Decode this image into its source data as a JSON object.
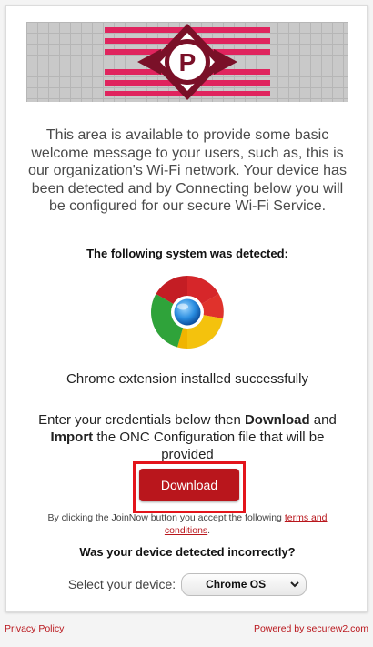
{
  "welcome_message": "This area is available to provide some basic welcome message to your users, such as, this is our organization's Wi-Fi network. Your device has been detected and by Connecting below you will be configured for our secure Wi-Fi Service.",
  "detection": {
    "heading": "The following system was detected:",
    "browser_icon": "chrome-icon",
    "status": "Chrome extension installed successfully"
  },
  "instructions": {
    "part1": "Enter your credentials below then ",
    "bold1": "Download",
    "part2": " and ",
    "bold2": "Import",
    "part3": " the ONC Configuration file that will be provided"
  },
  "download_button": {
    "label": "Download"
  },
  "terms": {
    "prefix": "By clicking the JoinNow button you accept the following ",
    "link_text": "terms and conditions",
    "suffix": "."
  },
  "device_section": {
    "heading": "Was your device detected incorrectly?",
    "select_label": "Select your device:",
    "selected_value": "Chrome OS"
  },
  "footer": {
    "privacy_link": "Privacy Policy",
    "powered_by": "Powered by securew2.com"
  },
  "colors": {
    "accent": "#b9161c",
    "highlight_outline": "#e3141b",
    "logo_pink": "#e0245e",
    "logo_dark": "#7a1028"
  },
  "logo": {
    "letter": "P"
  }
}
